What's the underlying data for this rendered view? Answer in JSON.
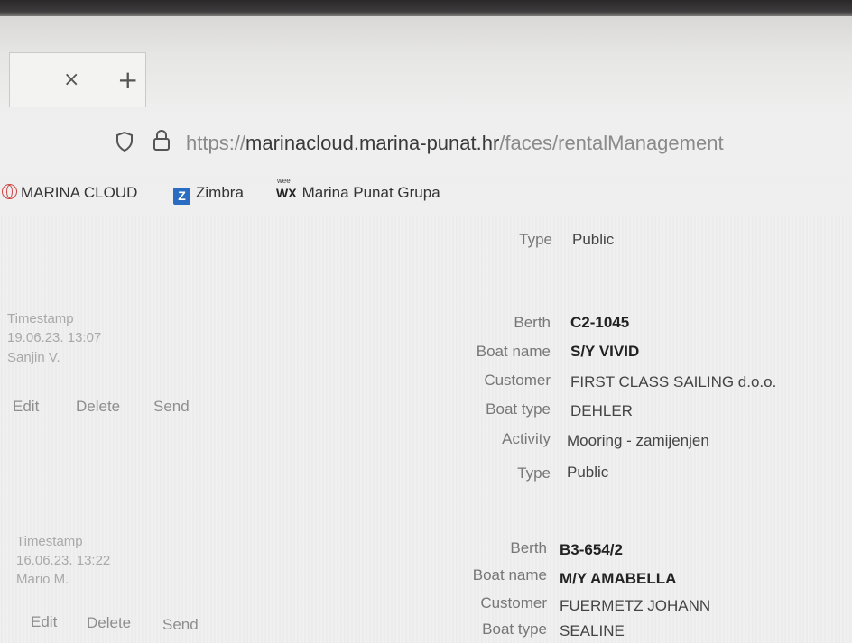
{
  "tab": {
    "close_symbol": "×",
    "new_tab_symbol": "+"
  },
  "address_bar": {
    "url_prefix": "https://",
    "url_host": "marinacloud.marina-punat.hr",
    "url_path": "/faces/rentalManagement",
    "icons": [
      "shield-icon",
      "lock-icon"
    ]
  },
  "bookmarks": [
    {
      "label": "MARINA CLOUD",
      "icon": "globe-icon"
    },
    {
      "label": "Zimbra",
      "icon": "zimbra-icon"
    },
    {
      "label": "Marina Punat Grupa",
      "icon": "wx-icon",
      "icon_text": "WX",
      "icon_small": "wee"
    }
  ],
  "labels": {
    "type": "Type",
    "berth": "Berth",
    "boat_name": "Boat name",
    "customer": "Customer",
    "boat_type": "Boat type",
    "activity": "Activity",
    "timestamp": "Timestamp",
    "edit": "Edit",
    "delete": "Delete",
    "send": "Send"
  },
  "top_partial": {
    "type": "Public"
  },
  "records": [
    {
      "timestamp": "19.06.23. 13:07",
      "user": "Sanjin V.",
      "berth": "C2-1045",
      "boat_name": "S/Y VIVID",
      "customer": "FIRST CLASS SAILING d.o.o.",
      "boat_type": "DEHLER",
      "activity": "Mooring - zamijenjen",
      "type": "Public"
    },
    {
      "timestamp": "16.06.23. 13:22",
      "user": "Mario M.",
      "berth": "B3-654/2",
      "boat_name": "M/Y AMABELLA",
      "customer": "FUERMETZ JOHANN",
      "boat_type": "SEALINE"
    }
  ],
  "colors": {
    "link_host": "#3a3a3a",
    "url_muted": "#8a8a8a",
    "zimbra_blue": "#2a6cc2"
  }
}
